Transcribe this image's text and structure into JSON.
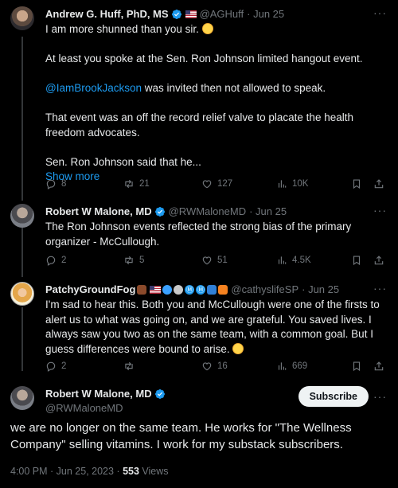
{
  "icons": {
    "reply": "reply-icon",
    "retweet": "retweet-icon",
    "like": "heart-icon",
    "views": "views-icon",
    "bookmark": "bookmark-icon",
    "share": "share-icon",
    "more": "more-icon"
  },
  "colors": {
    "accent": "#1d9bf0",
    "muted": "#71767b",
    "background": "#000000"
  },
  "tweets": [
    {
      "name": "Andrew G. Huff, PhD, MS",
      "handle": "@AGHuff",
      "date": "· Jun 25",
      "text": {
        "p1": "I am more shunned than you sir.",
        "p2": "At least you spoke at the Sen. Ron Johnson limited hangout event.",
        "p3_mention": "@IamBrookJackson",
        "p3_rest": " was invited then not allowed to speak.",
        "p4": "That event was an off the record relief valve to placate the health freedom advocates.",
        "p5": "Sen. Ron Johnson said that he...",
        "show_more": "Show more"
      },
      "stats": {
        "replies": "8",
        "retweets": "21",
        "likes": "127",
        "views": "10K"
      }
    },
    {
      "name": "Robert W Malone, MD",
      "handle": "@RWMaloneMD",
      "date": "· Jun 25",
      "text": "The Ron Johnson events reflected the strong bias of the primary organizer - McCullough.",
      "stats": {
        "replies": "2",
        "retweets": "5",
        "likes": "51",
        "views": "4.5K"
      }
    },
    {
      "name": "PatchyGroundFog",
      "handle": "@cathyslifeSP",
      "date": "· Jun 25",
      "badges": [
        "Ⓜ",
        "Ⓜ"
      ],
      "text": "I'm sad to hear this. Both you and McCullough were one of the firsts to alert us to what was going on, and we are grateful. You saved lives. I always saw you two as on the same team, with a common goal. But I guess differences were bound to arise.",
      "stats": {
        "replies": "2",
        "retweets": "",
        "likes": "16",
        "views": "669"
      }
    }
  ],
  "main_tweet": {
    "name": "Robert W Malone, MD",
    "handle": "@RWMaloneMD",
    "subscribe_label": "Subscribe",
    "text": "we are no longer on the same team.  He works for \"The Wellness Company\" selling vitamins.  I work for my substack subscribers.",
    "timestamp": "4:00 PM · Jun 25, 2023 · ",
    "views_count": "553",
    "views_label": " Views"
  }
}
